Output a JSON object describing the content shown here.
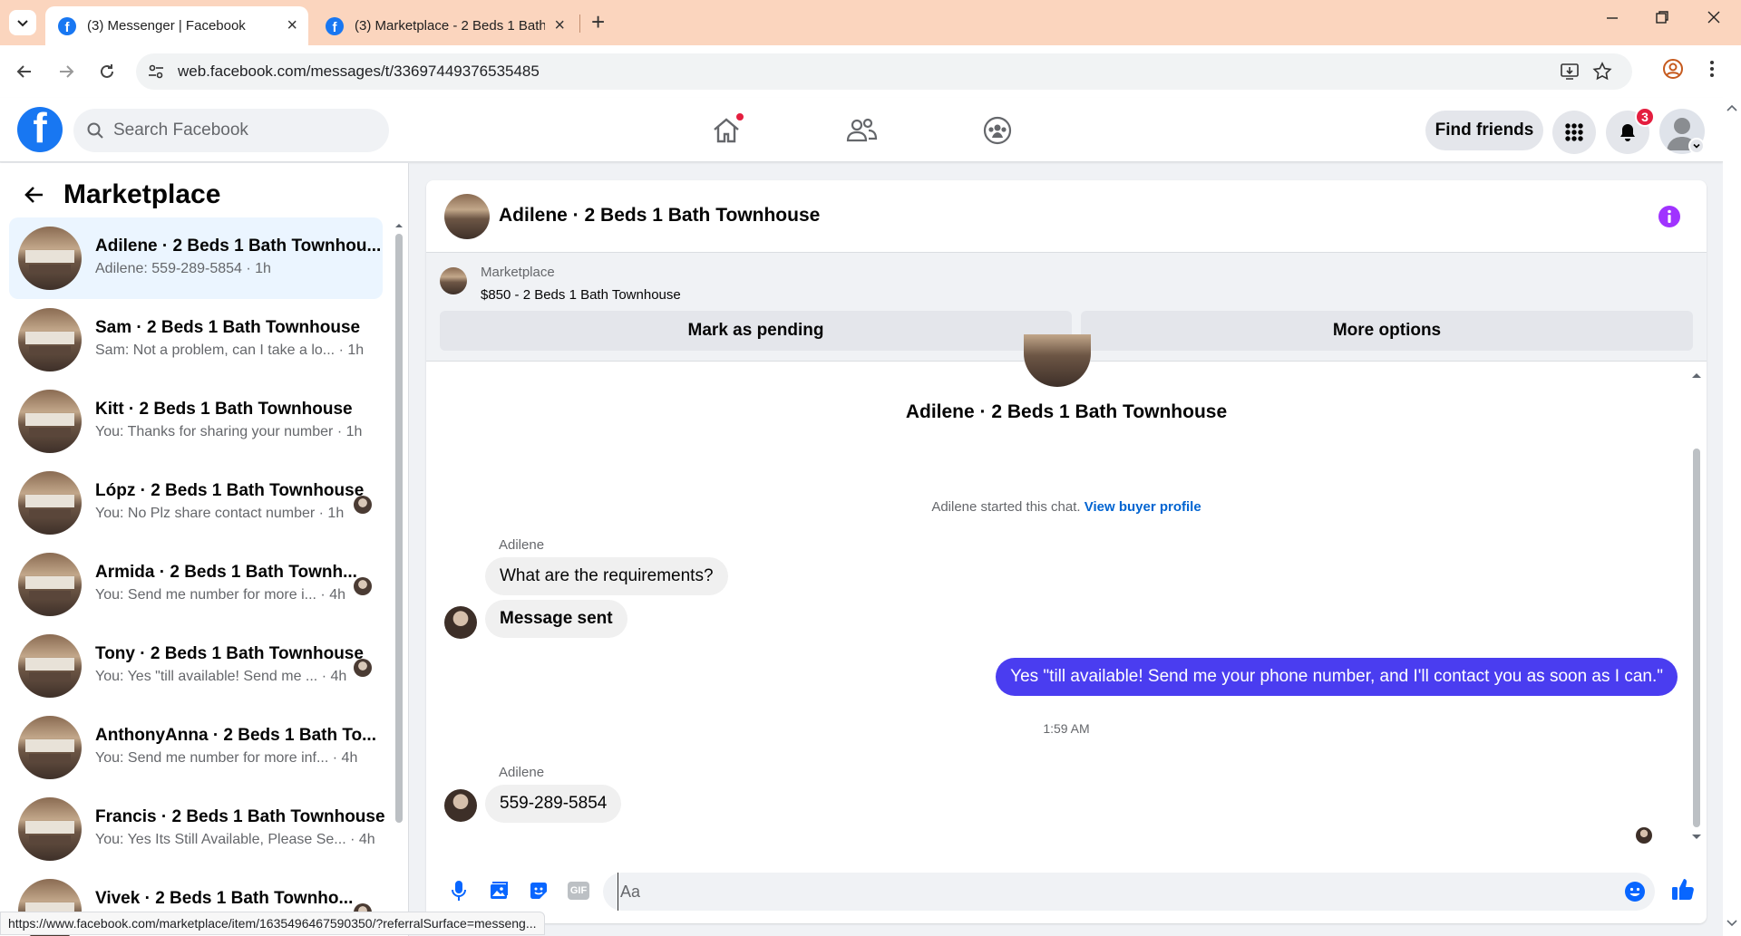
{
  "browser": {
    "tabs": [
      {
        "title": "(3) Messenger | Facebook",
        "active": true
      },
      {
        "title": "(3) Marketplace - 2 Beds 1 Bath",
        "active": false
      }
    ],
    "url": "web.facebook.com/messages/t/33697449376535485",
    "status_url": "https://www.facebook.com/marketplace/item/1635496467590350/?referralSurface=messeng..."
  },
  "fb_header": {
    "logo": "f",
    "search_placeholder": "Search Facebook",
    "find_friends": "Find friends",
    "notification_count": "3",
    "brand_color": "#1877f2"
  },
  "sidebar": {
    "title": "Marketplace",
    "conversations": [
      {
        "name": "Adilene · 2 Beds 1 Bath Townhou...",
        "preview": "Adilene: 559-289-5854 · 1h",
        "selected": true,
        "seen": false
      },
      {
        "name": "Sam · 2 Beds 1 Bath Townhouse",
        "preview": "Sam: Not a problem, can I take a lo... · 1h",
        "selected": false,
        "seen": false
      },
      {
        "name": "Kitt · 2 Beds 1 Bath Townhouse",
        "preview": "You: Thanks for sharing your number · 1h",
        "selected": false,
        "seen": false
      },
      {
        "name": "Lópz · 2 Beds 1 Bath Townhouse",
        "preview": "You: No Plz share contact number · 1h",
        "selected": false,
        "seen": true
      },
      {
        "name": "Armida · 2 Beds 1 Bath Townh...",
        "preview": "You: Send me number for more i... · 4h",
        "selected": false,
        "seen": true
      },
      {
        "name": "Tony · 2 Beds 1 Bath Townhouse",
        "preview": "You: Yes \"till available! Send me ... · 4h",
        "selected": false,
        "seen": true
      },
      {
        "name": "AnthonyAnna · 2 Beds 1 Bath To...",
        "preview": "You: Send me number for more inf... · 4h",
        "selected": false,
        "seen": false
      },
      {
        "name": "Francis · 2 Beds 1 Bath Townhouse",
        "preview": "You: Yes Its Still Available, Please Se... · 4h",
        "selected": false,
        "seen": false
      },
      {
        "name": "Vivek · 2 Beds 1 Bath Townho...",
        "preview": "",
        "selected": false,
        "seen": true
      }
    ]
  },
  "chat": {
    "title": "Adilene · 2 Beds 1 Bath Townhouse",
    "marketplace_label": "Marketplace",
    "listing": "$850 - 2 Beds 1 Bath Townhouse",
    "mark_pending": "Mark as pending",
    "more_options": "More options",
    "hero_name": "Adilene · 2 Beds 1 Bath Townhouse",
    "started_text": "Adilene started this chat.",
    "view_profile": "View buyer profile",
    "messages": [
      {
        "sender_label": "Adilene",
        "text": "What are the requirements?"
      },
      {
        "text": "Message sent"
      },
      {
        "text": "Yes \"till available! Send me your phone number, and I'll contact you as soon as I can.\""
      },
      {
        "timestamp": "1:59 AM"
      },
      {
        "sender_label": "Adilene",
        "text": "559-289-5854"
      }
    ],
    "composer_placeholder": "Aa",
    "accent_color": "#4a3df0"
  }
}
